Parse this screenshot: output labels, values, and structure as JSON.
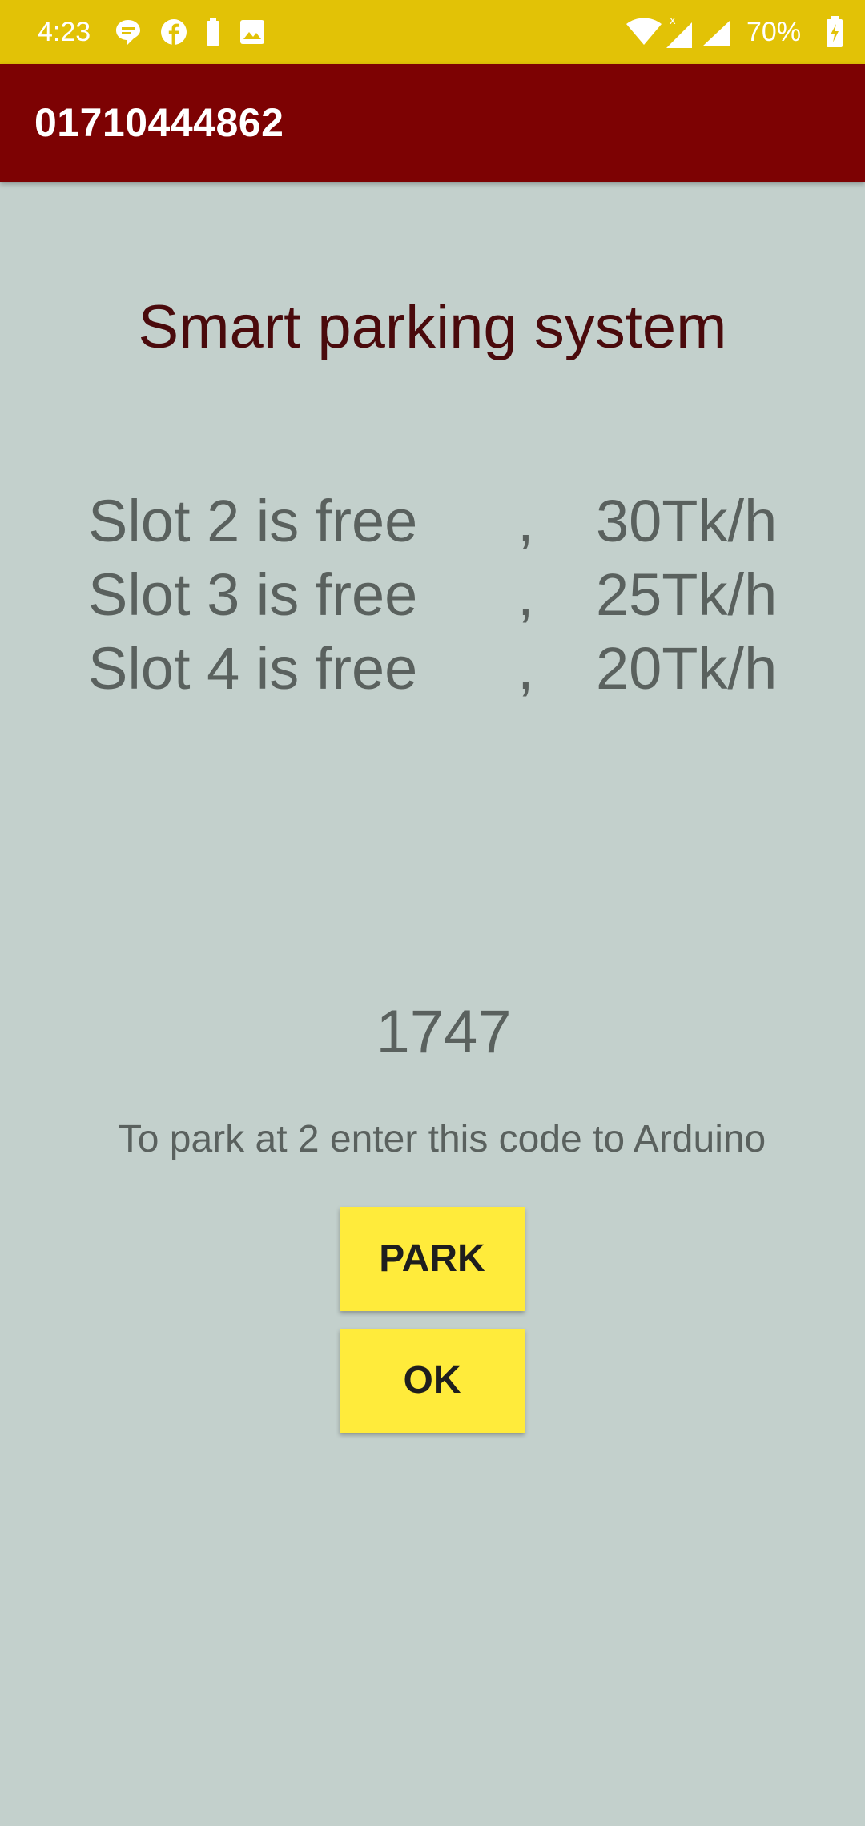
{
  "status_bar": {
    "time": "4:23",
    "battery_percent": "70%",
    "left_icons": [
      "chat-bubble-icon",
      "facebook-icon",
      "battery-saver-icon",
      "image-icon"
    ],
    "right_icons": [
      "wifi-icon",
      "signal-icon",
      "signal-icon",
      "battery-charging-icon"
    ],
    "color": "#E2C206"
  },
  "app_bar": {
    "title": "01710444862",
    "color": "#7D0203"
  },
  "main": {
    "heading": "Smart parking system",
    "slots": [
      {
        "text": "Slot 2 is free",
        "separator": ",",
        "rate": "30Tk/h"
      },
      {
        "text": "Slot 3 is free",
        "separator": ",",
        "rate": "25Tk/h"
      },
      {
        "text": "Slot 4 is free",
        "separator": ",",
        "rate": "20Tk/h"
      }
    ],
    "code": "1747",
    "instruction": "To park at 2 enter this code to Arduino",
    "park_button": "PARK",
    "ok_button": "OK",
    "button_color": "#FFEB3B",
    "background_color": "#C3D0CC"
  }
}
